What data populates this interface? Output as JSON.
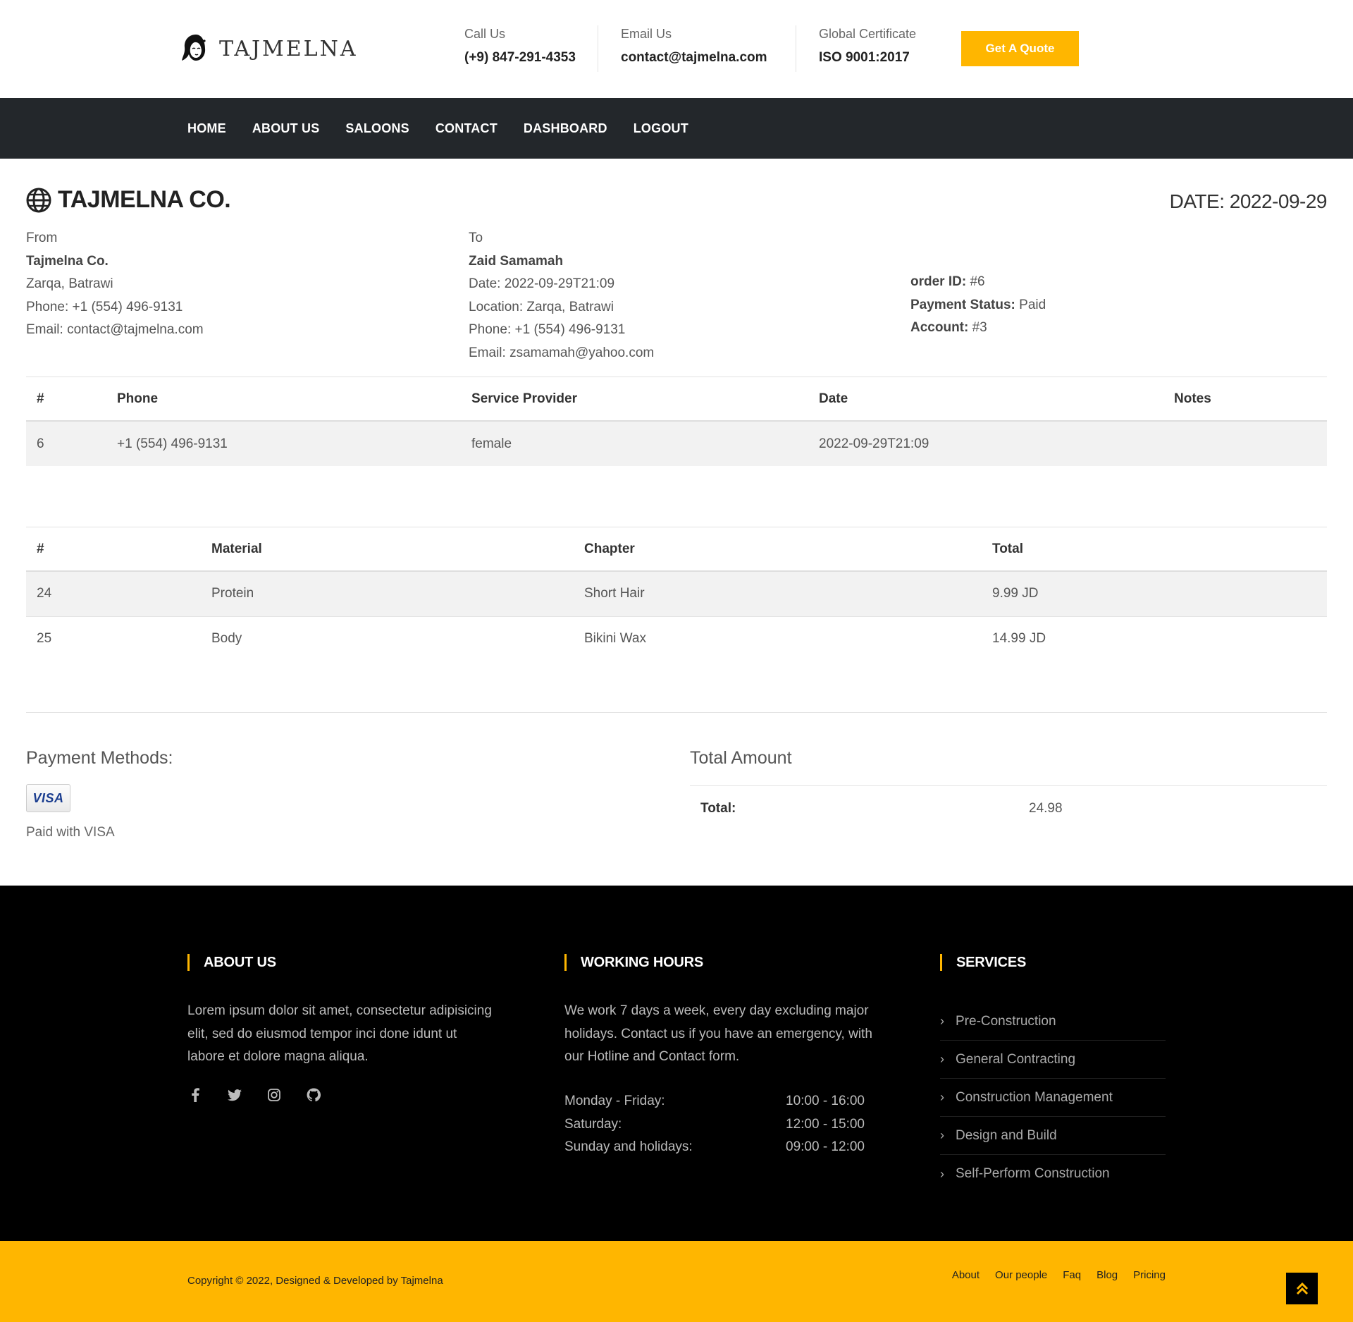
{
  "header": {
    "brand": "TAJMELNA",
    "call_label": "Call Us",
    "call_value": "(+9) 847-291-4353",
    "email_label": "Email Us",
    "email_value": "contact@tajmelna.com",
    "cert_label": "Global Certificate",
    "cert_value": "ISO 9001:2017",
    "quote_button": "Get A Quote",
    "accent_color": "#ffb600"
  },
  "nav": {
    "items": [
      "HOME",
      "ABOUT US",
      "SALOONS",
      "CONTACT",
      "DASHBOARD",
      "LOGOUT"
    ]
  },
  "invoice": {
    "company": "TAJMELNA CO.",
    "date": "DATE: 2022-09-29",
    "from": {
      "label": "From",
      "name": "Tajmelna Co.",
      "address": "Zarqa, Batrawi",
      "phone": "Phone: +1 (554) 496-9131",
      "email": "Email: contact@tajmelna.com"
    },
    "to": {
      "label": "To",
      "name": "Zaid Samamah",
      "date": "Date: 2022-09-29T21:09",
      "location": "Location: Zarqa, Batrawi",
      "phone": "Phone: +1 (554) 496-9131",
      "email": "Email: zsamamah@yahoo.com"
    },
    "meta": {
      "order_label": "order ID:",
      "order_value": "#6",
      "status_label": "Payment Status:",
      "status_value": "Paid",
      "account_label": "Account:",
      "account_value": "#3"
    },
    "booking_table": {
      "headers": [
        "#",
        "Phone",
        "Service Provider",
        "Date",
        "Notes"
      ],
      "rows": [
        [
          "6",
          "+1 (554) 496-9131",
          "female",
          "2022-09-29T21:09",
          ""
        ]
      ]
    },
    "items_table": {
      "headers": [
        "#",
        "Material",
        "Chapter",
        "Total"
      ],
      "rows": [
        [
          "24",
          "Protein",
          "Short Hair",
          "9.99 JD"
        ],
        [
          "25",
          "Body",
          "Bikini Wax",
          "14.99 JD"
        ]
      ]
    },
    "payment": {
      "title": "Payment Methods:",
      "card": "VISA",
      "note": "Paid with VISA"
    },
    "total": {
      "title": "Total Amount",
      "label": "Total:",
      "value": "24.98"
    }
  },
  "footer": {
    "about_title": "ABOUT US",
    "about_text": "Lorem ipsum dolor sit amet, consectetur adipisicing elit, sed do eiusmod tempor inci done idunt ut labore et dolore magna aliqua.",
    "social": [
      "facebook-icon",
      "twitter-icon",
      "instagram-icon",
      "github-icon"
    ],
    "hours_title": "WORKING HOURS",
    "hours_text": "We work 7 days a week, every day excluding major holidays. Contact us if you have an emergency, with our Hotline and Contact form.",
    "hours": [
      [
        "Monday - Friday:",
        "10:00 - 16:00"
      ],
      [
        "Saturday:",
        "12:00 - 15:00"
      ],
      [
        "Sunday and holidays:",
        "09:00 - 12:00"
      ]
    ],
    "services_title": "SERVICES",
    "services": [
      "Pre-Construction",
      "General Contracting",
      "Construction Management",
      "Design and Build",
      "Self-Perform Construction"
    ],
    "copyright": "Copyright © 2022, Designed & Developed by Tajmelna",
    "links": [
      "About",
      "Our people",
      "Faq",
      "Blog",
      "Pricing"
    ]
  }
}
